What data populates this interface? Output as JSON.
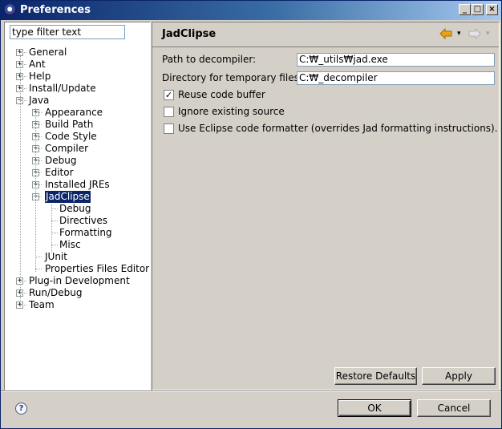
{
  "window": {
    "title": "Preferences",
    "controls": {
      "minimize": "_",
      "maximize": "□",
      "close": "×"
    }
  },
  "left": {
    "filter_value": "type filter text",
    "tree": [
      {
        "label": "General",
        "expander": "+"
      },
      {
        "label": "Ant",
        "expander": "+"
      },
      {
        "label": "Help",
        "expander": "+"
      },
      {
        "label": "Install/Update",
        "expander": "+"
      },
      {
        "label": "Java",
        "expander": "−"
      },
      {
        "label": "Appearance",
        "expander": "+"
      },
      {
        "label": "Build Path",
        "expander": "+"
      },
      {
        "label": "Code Style",
        "expander": "+"
      },
      {
        "label": "Compiler",
        "expander": "+"
      },
      {
        "label": "Debug",
        "expander": "+"
      },
      {
        "label": "Editor",
        "expander": "+"
      },
      {
        "label": "Installed JREs",
        "expander": "+"
      },
      {
        "label": "JadClipse",
        "expander": "−",
        "selected": true
      },
      {
        "label": "Debug"
      },
      {
        "label": "Directives"
      },
      {
        "label": "Formatting"
      },
      {
        "label": "Misc"
      },
      {
        "label": "JUnit"
      },
      {
        "label": "Properties Files Editor"
      },
      {
        "label": "Plug-in Development",
        "expander": "+"
      },
      {
        "label": "Run/Debug",
        "expander": "+"
      },
      {
        "label": "Team",
        "expander": "+"
      }
    ]
  },
  "page": {
    "title": "JadClipse",
    "nav": {
      "back_icon": "back-arrow-icon",
      "forward_icon": "forward-arrow-icon",
      "dropdown_icon": "▾"
    },
    "fields": [
      {
        "label": "Path to decompiler:",
        "value": "C:₩_utils₩jad.exe"
      },
      {
        "label": "Directory for temporary files:",
        "value": "C:₩_decompiler"
      }
    ],
    "checkboxes": [
      {
        "label": "Reuse code buffer",
        "checked": true,
        "mark": "✓"
      },
      {
        "label": "Ignore existing source",
        "checked": false,
        "mark": ""
      },
      {
        "label": "Use Eclipse code formatter (overrides Jad formatting instructions).",
        "checked": false,
        "mark": ""
      }
    ],
    "restore_defaults": "Restore Defaults",
    "apply": "Apply"
  },
  "footer": {
    "help_glyph": "?",
    "ok": "OK",
    "cancel": "Cancel"
  },
  "colors": {
    "title_bar": "#0a246a",
    "selection": "#0a246a",
    "face": "#d4d0c8",
    "back_arrow": "#e8a317"
  }
}
